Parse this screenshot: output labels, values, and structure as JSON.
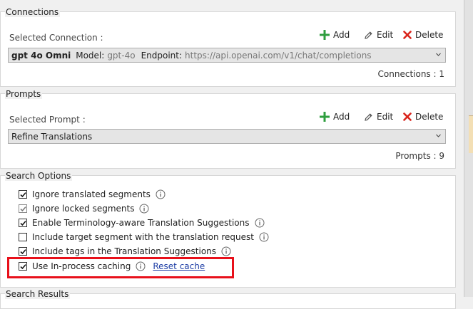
{
  "connections": {
    "legend": "Connections",
    "selected_label": "Selected Connection :",
    "add_label": "Add",
    "edit_label": "Edit",
    "delete_label": "Delete",
    "selected": {
      "name": "gpt 4o Omni",
      "model_key": "Model:",
      "model_value": "gpt-4o",
      "endpoint_key": "Endpoint:",
      "endpoint_value": "https://api.openai.com/v1/chat/completions"
    },
    "count_text": "Connections : 1"
  },
  "prompts": {
    "legend": "Prompts",
    "selected_label": "Selected Prompt :",
    "add_label": "Add",
    "edit_label": "Edit",
    "delete_label": "Delete",
    "selected": "Refine Translations",
    "count_text": "Prompts : 9"
  },
  "search_options": {
    "legend": "Search Options",
    "options": [
      {
        "label": "Ignore translated segments",
        "checked": true,
        "enabled": true
      },
      {
        "label": "Ignore locked segments",
        "checked": true,
        "enabled": false
      },
      {
        "label": "Enable Terminology-aware Translation Suggestions",
        "checked": true,
        "enabled": true
      },
      {
        "label": "Include target segment with the translation request",
        "checked": false,
        "enabled": true
      },
      {
        "label": "Include tags in the Translation Suggestions",
        "checked": true,
        "enabled": true
      },
      {
        "label": "Use In-process caching",
        "checked": true,
        "enabled": true
      }
    ],
    "reset_cache_label": "Reset cache"
  },
  "search_results": {
    "legend": "Search Results"
  },
  "colors": {
    "add_icon": "#2e9e3e",
    "delete_icon": "#d9241b",
    "highlight_box": "#e8101a",
    "link": "#1f3fa6"
  },
  "icons": [
    "plus-icon",
    "pencil-icon",
    "delete-x-icon",
    "chevron-down-icon",
    "info-icon",
    "checkmark-icon"
  ]
}
